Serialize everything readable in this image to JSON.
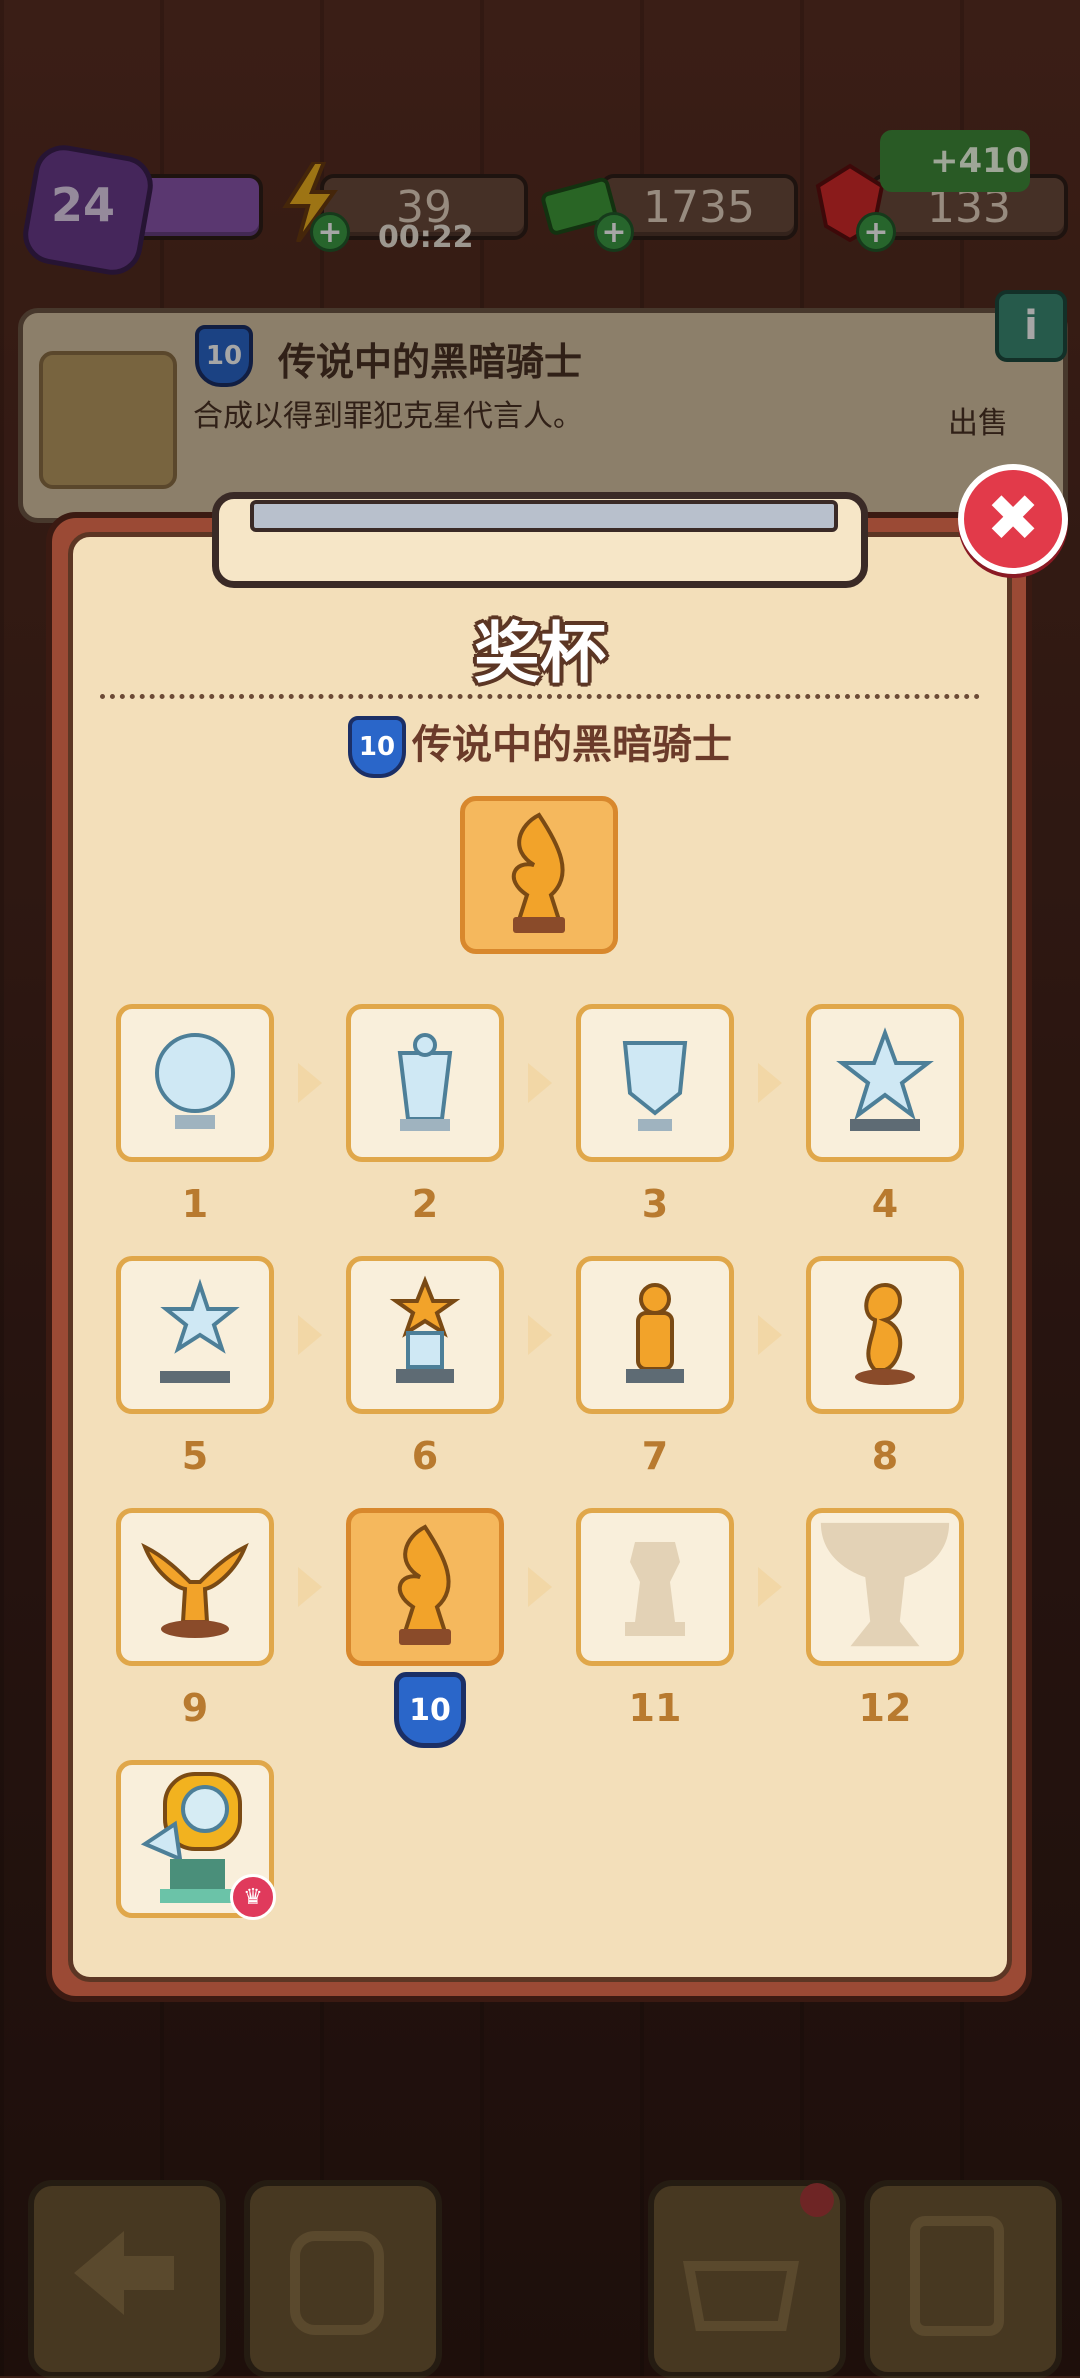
{
  "hud": {
    "level": "24",
    "energy": "39",
    "energy_timer": "00:22",
    "cash": "1735",
    "gems": "133"
  },
  "item_info": {
    "level": "10",
    "title": "传说中的黑暗骑士",
    "description": "合成以得到罪犯克星代言人。",
    "sell_label": "出售",
    "sell_price": "+410",
    "info_label": "i"
  },
  "panel": {
    "title": "奖杯",
    "subtitle_level": "10",
    "subtitle": "传说中的黑暗骑士",
    "close_label": "✖"
  },
  "trophies": [
    {
      "num": "1"
    },
    {
      "num": "2"
    },
    {
      "num": "3"
    },
    {
      "num": "4"
    },
    {
      "num": "5"
    },
    {
      "num": "6"
    },
    {
      "num": "7"
    },
    {
      "num": "8"
    },
    {
      "num": "9"
    },
    {
      "num": "10"
    },
    {
      "num": "11"
    },
    {
      "num": "12"
    }
  ],
  "current_slot_level": "10",
  "colors": {
    "accent_gold": "#e0a74a",
    "active_slot": "#f5b85d",
    "close_red": "#e23a4a",
    "level_shield": "#2a66c9"
  }
}
